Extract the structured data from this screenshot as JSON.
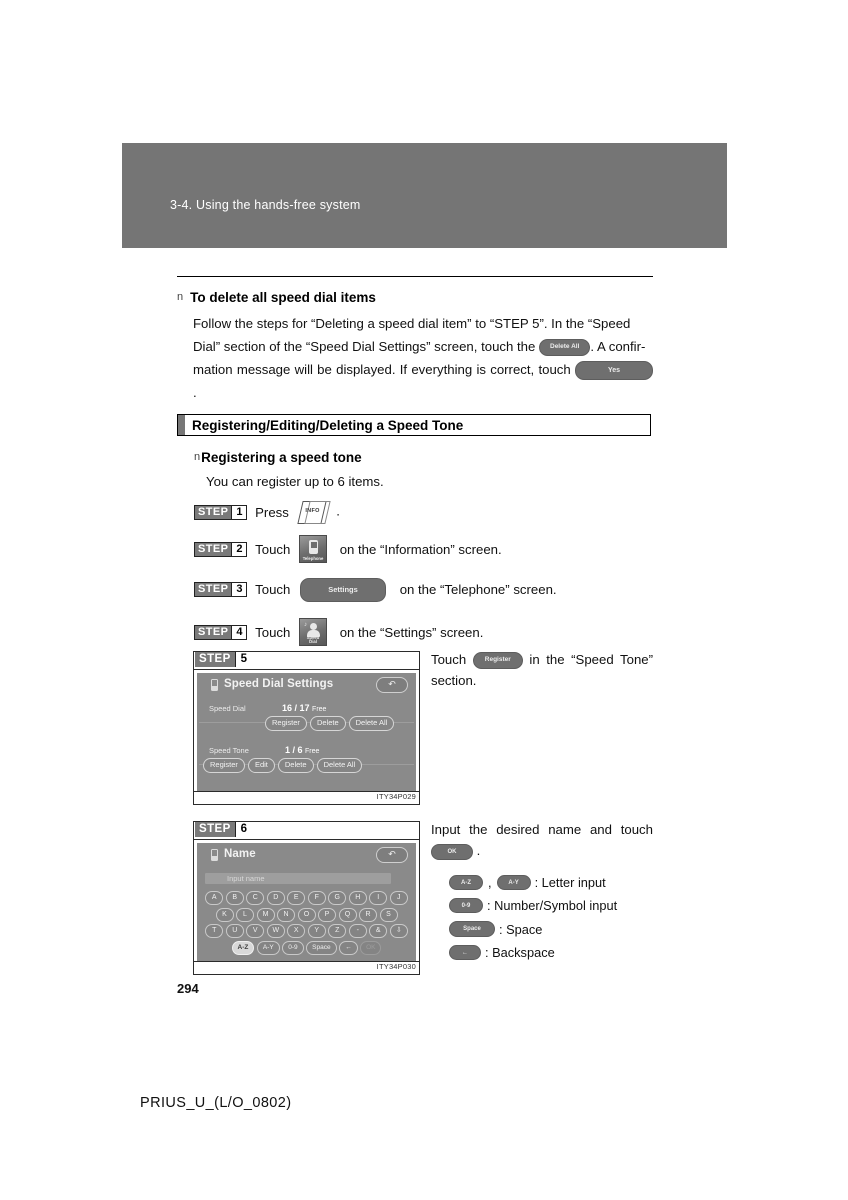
{
  "header": {
    "chapter_title": "3-4. Using the hands-free system"
  },
  "intro": {
    "bullet": "n",
    "heading": "To delete all speed dial items",
    "line1": "Follow the steps for “Deleting a speed dial item” to “STEP 5”. In the “Speed",
    "line2a": "Dial” section of the “Speed Dial Settings” screen, touch the",
    "btn_delete_all": "Delete All",
    "line2b": ". A confir-",
    "line3a": "mation message will be displayed. If everything is correct, touch",
    "btn_yes": "Yes",
    "line3b": "."
  },
  "section": {
    "title": "Registering/Editing/Deleting a Speed Tone"
  },
  "sub": {
    "bullet": "n",
    "heading": "Registering a speed tone",
    "note": "You can register up to 6 items."
  },
  "steps": {
    "word": "STEP",
    "s1": {
      "num": "1",
      "verb": "Press",
      "key_label": "INFO",
      "tail": "."
    },
    "s2": {
      "num": "2",
      "verb": "Touch",
      "icon_caption": "Telephone",
      "tail": "on the “Information” screen."
    },
    "s3": {
      "num": "3",
      "verb": "Touch",
      "button": "Settings",
      "tail": "on the “Telephone” screen."
    },
    "s4": {
      "num": "4",
      "verb": "Touch",
      "icon_caption_1": "Speed",
      "icon_caption_2": "Dial",
      "tail": "on the “Settings” screen."
    },
    "s5": {
      "num": "5"
    },
    "s6": {
      "num": "6"
    }
  },
  "figure5": {
    "caption": "ITY34P029",
    "screen": {
      "title": "Speed Dial Settings",
      "back_icon": "back-arrow-icon",
      "speed_dial": {
        "label": "Speed Dial",
        "count": "16 / 17",
        "free": "Free",
        "buttons": [
          "Register",
          "Delete",
          "Delete All"
        ]
      },
      "speed_tone": {
        "label": "Speed Tone",
        "count": "1 /  6",
        "free": "Free",
        "buttons": [
          "Register",
          "Edit",
          "Delete",
          "Delete All"
        ]
      }
    },
    "side_text_a": "Touch",
    "side_button": "Register",
    "side_text_b": "in the “Speed Tone” section."
  },
  "figure6": {
    "caption": "ITY34P030",
    "screen": {
      "title": "Name",
      "back_icon": "back-arrow-icon",
      "input_placeholder": "Input name",
      "keyboard": {
        "row1": [
          "A",
          "B",
          "C",
          "D",
          "E",
          "F",
          "G",
          "H",
          "I",
          "J"
        ],
        "row2": [
          "K",
          "L",
          "M",
          "N",
          "O",
          "P",
          "Q",
          "R",
          "S"
        ],
        "row3": [
          "T",
          "U",
          "V",
          "W",
          "X",
          "Y",
          "Z",
          "-",
          "&",
          "⇩"
        ],
        "row4": [
          "A-Z",
          "A-Y",
          "0-9",
          "Space",
          "←",
          "OK"
        ]
      }
    },
    "side_text_a": "Input the desired name and touch",
    "side_button": "OK",
    "side_text_b": ".",
    "legend": [
      {
        "keys": [
          "A-Z",
          "A-Y"
        ],
        "sep": ",",
        "desc": ": Letter input"
      },
      {
        "keys": [
          "0-9"
        ],
        "desc": ": Number/Symbol input"
      },
      {
        "keys": [
          "Space"
        ],
        "desc": ": Space"
      },
      {
        "keys": [
          "←"
        ],
        "desc": ": Backspace"
      }
    ]
  },
  "footer": {
    "page_number": "294",
    "book_code": "PRIUS_U_(L/O_0802)"
  },
  "colors": {
    "band": "#757575",
    "screen_bg": "#8a8a8a",
    "pill": "#6f6f6f"
  }
}
